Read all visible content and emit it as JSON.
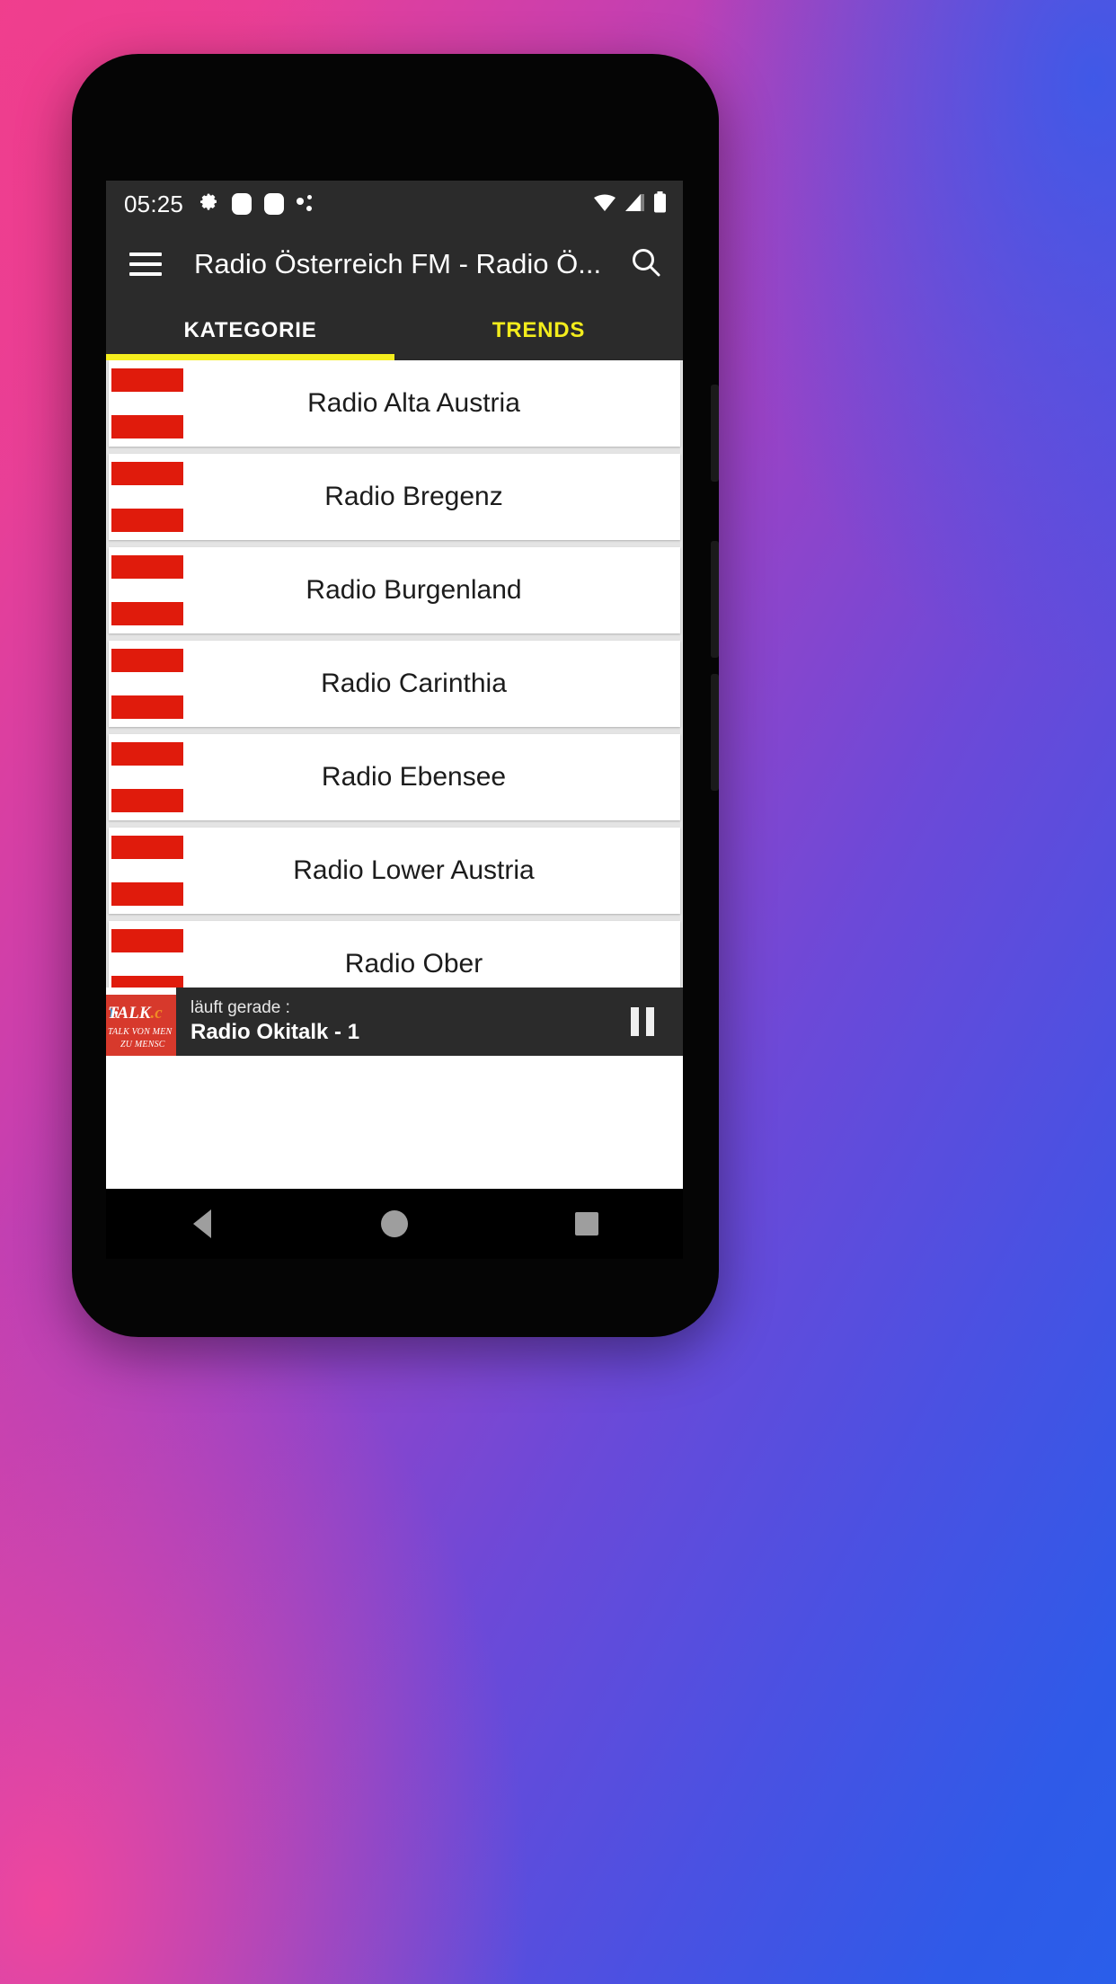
{
  "status_bar": {
    "time": "05:25",
    "left_icons": [
      "gear-icon",
      "rounded-square-icon",
      "rounded-square-icon",
      "dots-icon"
    ],
    "right_icons": [
      "wifi-icon",
      "cellular-signal-icon",
      "battery-icon"
    ]
  },
  "app_bar": {
    "menu_icon": "hamburger-menu-icon",
    "title": "Radio Österreich FM - Radio Ö...",
    "search_icon": "search-icon"
  },
  "tabs": {
    "items": [
      {
        "label": "KATEGORIE",
        "active": true
      },
      {
        "label": "TRENDS",
        "active": false
      }
    ],
    "active_color": "#ffffff",
    "inactive_color": "#f2ec1c",
    "indicator_color": "#f5ee1e"
  },
  "station_list": {
    "flag_icon": "austria-flag-icon",
    "flag_colors": {
      "red": "#e01b0c",
      "white": "#ffffff"
    },
    "items": [
      {
        "name": "Radio Alta Austria"
      },
      {
        "name": "Radio Bregenz"
      },
      {
        "name": "Radio Burgenland"
      },
      {
        "name": "Radio Carinthia"
      },
      {
        "name": "Radio Ebensee"
      },
      {
        "name": "Radio Lower Austria"
      },
      {
        "name": "Radio Ober"
      }
    ]
  },
  "now_playing": {
    "label": "läuft gerade :",
    "title": "Radio Okitalk - 1",
    "artwork": {
      "icon": "okitalk-logo-icon",
      "brand_prefix": "TALK",
      "brand_suffix": ".c",
      "tagline_line1": "TALK VON MEN",
      "tagline_line2": "ZU MENSC"
    },
    "pause_icon": "pause-icon"
  },
  "nav_bar": {
    "back": "back-triangle-icon",
    "home": "home-circle-icon",
    "recents": "recents-square-icon"
  }
}
